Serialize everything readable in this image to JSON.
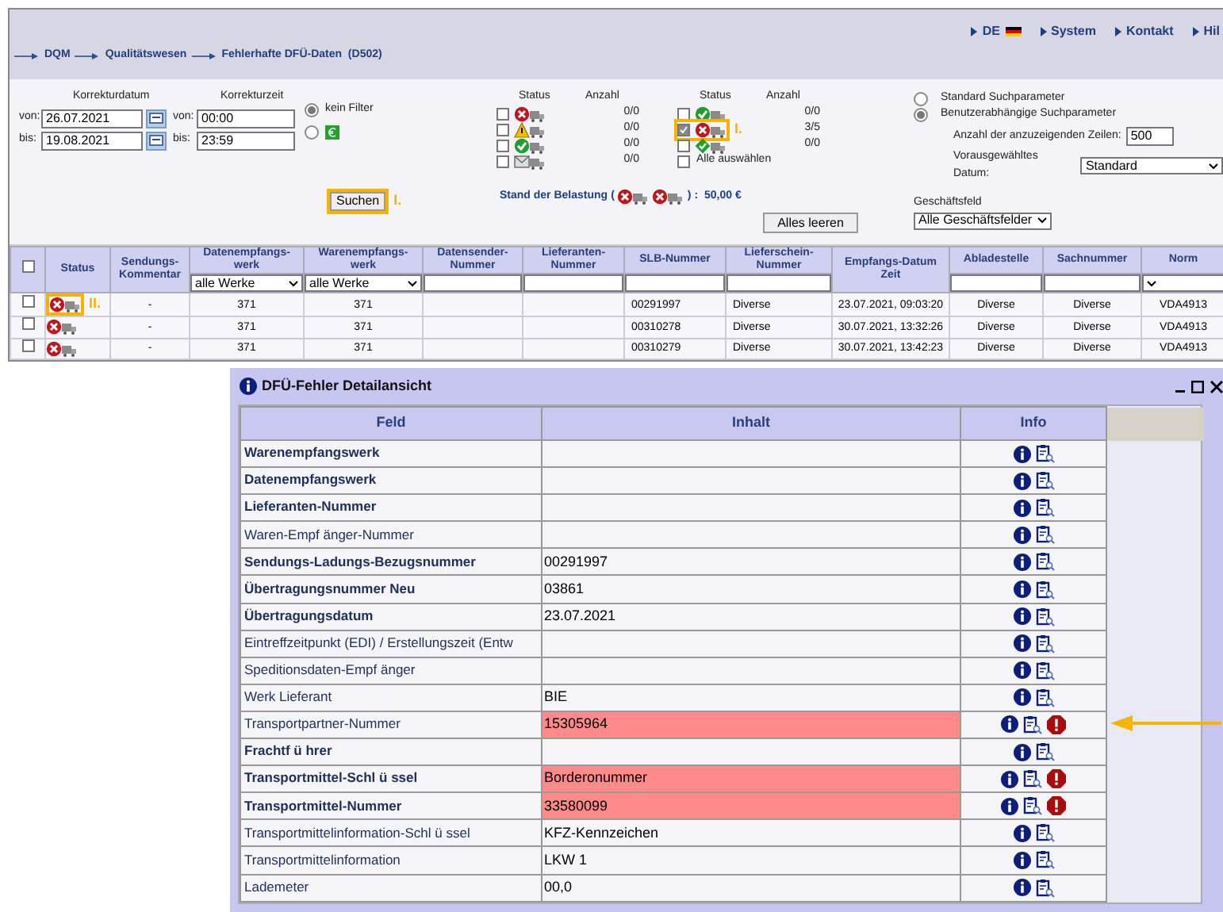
{
  "header": {
    "nav": [
      {
        "kind": "language",
        "label": "DE"
      },
      {
        "kind": "link",
        "label": "System"
      },
      {
        "kind": "link",
        "label": "Kontakt"
      },
      {
        "kind": "link",
        "label": "Hil"
      }
    ],
    "breadcrumb": [
      "DQM",
      "Qualitätswesen",
      "Fehlerhafte DFÜ-Daten  (D502)"
    ]
  },
  "search_form": {
    "date": {
      "label": "Korrekturdatum",
      "from_label": "von:",
      "from": "26.07.2021",
      "to_label": "bis:",
      "to": "19.08.2021"
    },
    "time": {
      "label": "Korrekturzeit",
      "from_label": "von:",
      "from": "00:00",
      "to_label": "bis:",
      "to": "23:59"
    },
    "filter_radios": [
      {
        "kind": "text",
        "label": "kein Filter",
        "selected": true
      },
      {
        "kind": "euro",
        "selected": false
      }
    ],
    "status_groups": [
      {
        "status_heading": "Status",
        "count_heading": "Anzahl",
        "items": [
          {
            "kind": "error",
            "checked": false,
            "count": "0/0"
          },
          {
            "kind": "warning",
            "checked": false,
            "count": "0/0"
          },
          {
            "kind": "ok",
            "checked": false,
            "count": "0/0"
          },
          {
            "kind": "mail",
            "checked": false,
            "count": "0/0"
          }
        ]
      },
      {
        "status_heading": "Status",
        "count_heading": "Anzahl",
        "items": [
          {
            "kind": "ok",
            "checked": false,
            "count": "0/0"
          },
          {
            "kind": "error",
            "checked": true,
            "count": "3/5",
            "annotation": "I."
          },
          {
            "kind": "diamond",
            "checked": false,
            "count": "0/0"
          },
          {
            "kind": "select-all",
            "checked": false,
            "label": "Alle auswählen"
          }
        ]
      }
    ],
    "charge": {
      "label": "Stand der Belastung",
      "open": "(",
      "close": ")",
      "amount": ":  50,00 €"
    },
    "search_button": {
      "label": "Suchen",
      "annotation": "I."
    },
    "clear_button": "Alles leeren",
    "param_radios": [
      {
        "label": "Standard Suchparameter",
        "selected": false
      },
      {
        "label": "Benutzerabhängige Suchparameter",
        "selected": true
      }
    ],
    "rows_label": "Anzahl der anzuzeigenden Zeilen:",
    "rows_value": "500",
    "date_label": "Vorausgewähltes Datum:",
    "date_value": "Standard",
    "business_label": "Geschäftsfeld",
    "business_value": "Alle Geschäftsfelder"
  },
  "results": {
    "select_all_checked": false,
    "columns": [
      "Status",
      "Sendungs-Kommentar",
      "Datenempfangs-werk",
      "Warenempfangs-werk",
      "Datensender-Nummer",
      "Lieferanten-Nummer",
      "SLB-Nummer",
      "Lieferschein-Nummer",
      "Empfangs-Datum  Zeit",
      "Abladestelle",
      "Sachnummer",
      "Norm"
    ],
    "filters": [
      {
        "kind": "none"
      },
      {
        "kind": "none"
      },
      {
        "kind": "select",
        "value": "alle Werke"
      },
      {
        "kind": "select",
        "value": "alle Werke"
      },
      {
        "kind": "input"
      },
      {
        "kind": "input"
      },
      {
        "kind": "input"
      },
      {
        "kind": "input"
      },
      {
        "kind": "none"
      },
      {
        "kind": "input"
      },
      {
        "kind": "input"
      },
      {
        "kind": "select"
      }
    ],
    "rows": [
      {
        "kind": "error",
        "checked": false,
        "annotation": "II.",
        "cells": [
          "",
          "-",
          "371",
          "371",
          "",
          "",
          "00291997",
          "Diverse",
          "23.07.2021, 09:03:20",
          "Diverse",
          "Diverse",
          "VDA4913"
        ]
      },
      {
        "kind": "error",
        "checked": false,
        "cells": [
          "",
          "-",
          "371",
          "371",
          "",
          "",
          "00310278",
          "Diverse",
          "30.07.2021, 13:32:26",
          "Diverse",
          "Diverse",
          "VDA4913"
        ]
      },
      {
        "kind": "error",
        "checked": false,
        "cells": [
          "",
          "-",
          "371",
          "371",
          "",
          "",
          "00310279",
          "Diverse",
          "30.07.2021, 13:42:23",
          "Diverse",
          "Diverse",
          "VDA4913"
        ]
      }
    ]
  },
  "detail": {
    "title": "DFÜ-Fehler Detailansicht",
    "columns": [
      "Feld",
      "Inhalt",
      "Info"
    ],
    "rows": [
      {
        "field": "Warenempfangswerk",
        "bold": true,
        "value": "",
        "error": false
      },
      {
        "field": "Datenempfangswerk",
        "bold": true,
        "value": "",
        "error": false
      },
      {
        "field": "Lieferanten-Nummer",
        "bold": true,
        "value": "",
        "error": false
      },
      {
        "field": "Waren-Empf änger-Nummer",
        "bold": false,
        "value": "",
        "error": false
      },
      {
        "field": "Sendungs-Ladungs-Bezugsnummer",
        "bold": true,
        "value": "00291997",
        "error": false
      },
      {
        "field": "Übertragungsnummer Neu",
        "bold": true,
        "value": "03861",
        "error": false
      },
      {
        "field": "Übertragungsdatum",
        "bold": true,
        "value": "23.07.2021",
        "error": false
      },
      {
        "field": "Eintreffzeitpunkt (EDI) / Erstellungszeit (Entw",
        "bold": false,
        "value": "",
        "error": false
      },
      {
        "field": "Speditionsdaten-Empf änger",
        "bold": false,
        "value": "",
        "error": false
      },
      {
        "field": "Werk Lieferant",
        "bold": false,
        "value": "BIE",
        "error": false
      },
      {
        "field": "Transportpartner-Nummer",
        "bold": false,
        "value": "15305964",
        "error": true,
        "pointer": true
      },
      {
        "field": "Frachtf ü hrer",
        "bold": true,
        "value": "",
        "error": false
      },
      {
        "field": "Transportmittel-Schl ü ssel",
        "bold": true,
        "value": "Borderonummer",
        "error": true
      },
      {
        "field": "Transportmittel-Nummer",
        "bold": true,
        "value": "33580099",
        "error": true
      },
      {
        "field": "Transportmittelinformation-Schl ü ssel",
        "bold": false,
        "value": "KFZ-Kennzeichen",
        "error": false
      },
      {
        "field": "Transportmittelinformation",
        "bold": false,
        "value": "LKW 1",
        "error": false
      },
      {
        "field": "Lademeter",
        "bold": false,
        "value": "00,0",
        "error": false
      }
    ]
  }
}
